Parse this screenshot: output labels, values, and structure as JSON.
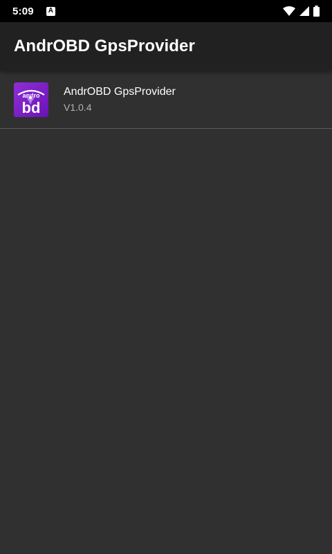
{
  "status_bar": {
    "time": "5:09",
    "notification_icon": "a-letter-icon",
    "wifi_icon": "wifi-icon",
    "signal_icon": "cell-signal-icon",
    "battery_icon": "battery-icon"
  },
  "app_bar": {
    "title": "AndrOBD GpsProvider"
  },
  "list": {
    "items": [
      {
        "icon": "androbd-app-icon",
        "title": "AndrOBD GpsProvider",
        "subtitle": "V1.0.4"
      }
    ]
  },
  "colors": {
    "status_bar_bg": "#000000",
    "app_bar_bg": "#212121",
    "content_bg": "#303030",
    "icon_purple": "#7a1fc2",
    "divider": "#5a5a5a"
  }
}
